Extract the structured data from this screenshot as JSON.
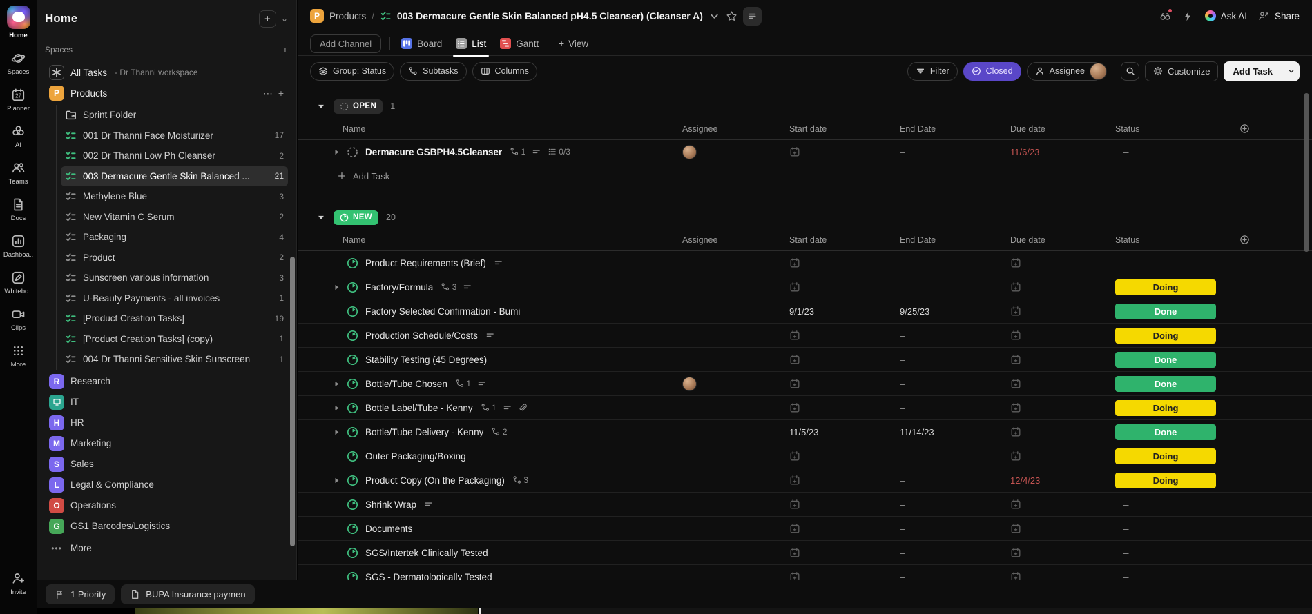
{
  "colors": {
    "accent_purple": "#5a47c8",
    "status_doing": "#f5d900",
    "status_done": "#2fb36c",
    "overdue_red": "#c25351",
    "green_icon": "#3fbf7f",
    "project_badge_yellow": "#eda43c"
  },
  "rail": {
    "items": [
      {
        "icon": "home-logo",
        "label": "Home"
      },
      {
        "icon": "planet-icon",
        "label": "Spaces"
      },
      {
        "icon": "calendar-icon",
        "label": "Planner"
      },
      {
        "icon": "ai-flower-icon",
        "label": "AI"
      },
      {
        "icon": "people-icon",
        "label": "Teams"
      },
      {
        "icon": "document-icon",
        "label": "Docs"
      },
      {
        "icon": "bar-chart-icon",
        "label": "Dashboa.."
      },
      {
        "icon": "whiteboard-icon",
        "label": "Whitebo.."
      },
      {
        "icon": "video-icon",
        "label": "Clips"
      },
      {
        "icon": "dots-grid-icon",
        "label": "More"
      }
    ],
    "invite": {
      "icon": "person-add-icon",
      "label": "Invite"
    }
  },
  "sidebar": {
    "title": "Home",
    "spaces_label": "Spaces",
    "all_tasks": {
      "label": "All Tasks",
      "suffix": "- Dr Thanni workspace"
    },
    "project": {
      "badge": "P",
      "badge_color": "#eda43c",
      "label": "Products"
    },
    "lists": [
      {
        "icon": "folder-icon",
        "label": "Sprint Folder",
        "count": ""
      },
      {
        "icon": "checklist-green-icon",
        "label": "001 Dr Thanni Face Moisturizer",
        "count": "17"
      },
      {
        "icon": "checklist-green-icon",
        "label": "002 Dr Thanni Low Ph Cleanser",
        "count": "2"
      },
      {
        "icon": "checklist-green-icon",
        "label": "003 Dermacure Gentle Skin Balanced ...",
        "count": "21",
        "selected": true
      },
      {
        "icon": "checklist-gray-icon",
        "label": "Methylene Blue",
        "count": "3"
      },
      {
        "icon": "checklist-gray-icon",
        "label": "New Vitamin C Serum",
        "count": "2"
      },
      {
        "icon": "checklist-gray-icon",
        "label": "Packaging",
        "count": "4"
      },
      {
        "icon": "checklist-gray-icon",
        "label": "Product",
        "count": "2"
      },
      {
        "icon": "checklist-gray-icon",
        "label": "Sunscreen various information",
        "count": "3"
      },
      {
        "icon": "checklist-gray-icon",
        "label": "U-Beauty Payments - all invoices",
        "count": "1"
      },
      {
        "icon": "checklist-green-icon",
        "label": "[Product Creation Tasks]",
        "count": "19"
      },
      {
        "icon": "checklist-green-icon",
        "label": "[Product Creation Tasks] (copy)",
        "count": "1"
      },
      {
        "icon": "checklist-gray-icon",
        "label": "004 Dr Thanni Sensitive Skin Sunscreen",
        "count": "1"
      }
    ],
    "spaces": [
      {
        "letter": "R",
        "color": "#7b68ee",
        "label": "Research"
      },
      {
        "letter": "",
        "glyph": "monitor-icon",
        "color": "#2ba58f",
        "label": "IT"
      },
      {
        "letter": "H",
        "color": "#7b68ee",
        "label": "HR"
      },
      {
        "letter": "M",
        "color": "#7b68ee",
        "label": "Marketing"
      },
      {
        "letter": "S",
        "color": "#7b68ee",
        "label": "Sales"
      },
      {
        "letter": "L",
        "color": "#7b68ee",
        "label": "Legal & Compliance"
      },
      {
        "letter": "O",
        "color": "#d14b44",
        "label": "Operations"
      },
      {
        "letter": "G",
        "color": "#46a758",
        "label": "GS1 Barcodes/Logistics"
      }
    ],
    "more_label": "More"
  },
  "header": {
    "breadcrumb": {
      "project_badge": "P",
      "project": "Products",
      "separator": "/",
      "title": "003 Dermacure Gentle Skin Balanced pH4.5 Cleanser) (Cleanser A)"
    },
    "ask_ai_label": "Ask AI",
    "share_label": "Share"
  },
  "tabs": {
    "add_channel": "Add Channel",
    "board": "Board",
    "list": "List",
    "gantt": "Gantt",
    "add_view": "View"
  },
  "toolbar": {
    "group": "Group: Status",
    "subtasks": "Subtasks",
    "columns": "Columns",
    "filter": "Filter",
    "closed": "Closed",
    "assignee": "Assignee",
    "customize": "Customize",
    "add_task": "Add Task"
  },
  "table": {
    "columns": [
      "Name",
      "Assignee",
      "Start date",
      "End Date",
      "Due date",
      "Status"
    ],
    "groups": [
      {
        "badge": "OPEN",
        "style": "open",
        "count": "1",
        "add_task_label": "Add Task",
        "rows": [
          {
            "name": "Dermacure GSBPH4.5Cleanser",
            "bold": true,
            "expandable": true,
            "icon": "dashed-circle-icon",
            "sub": "1",
            "desc": true,
            "checklist": "0/3",
            "assignee": "avatar",
            "start": "",
            "end": "–",
            "due": "11/6/23",
            "due_red": true,
            "status": "–"
          }
        ]
      },
      {
        "badge": "NEW",
        "style": "new",
        "count": "20",
        "rows": [
          {
            "name": "Product Requirements (Brief)",
            "icon": "clock-icon",
            "desc": true,
            "end": "–",
            "status": "–"
          },
          {
            "name": "Factory/Formula",
            "expandable": true,
            "icon": "clock-icon",
            "sub": "3",
            "desc": true,
            "end": "–",
            "status": "Doing"
          },
          {
            "name": "Factory Selected Confirmation - Bumi",
            "icon": "clock-icon",
            "start": "9/1/23",
            "end": "9/25/23",
            "status": "Done"
          },
          {
            "name": "Production Schedule/Costs",
            "icon": "clock-icon",
            "desc": true,
            "end": "–",
            "status": "Doing"
          },
          {
            "name": "Stability Testing (45 Degrees)",
            "icon": "clock-icon",
            "end": "–",
            "status": "Done"
          },
          {
            "name": "Bottle/Tube Chosen",
            "expandable": true,
            "icon": "clock-icon",
            "sub": "1",
            "desc": true,
            "assignee": "avatar",
            "end": "–",
            "status": "Done"
          },
          {
            "name": "Bottle Label/Tube - Kenny",
            "expandable": true,
            "icon": "clock-icon",
            "sub": "1",
            "desc": true,
            "attach": true,
            "end": "–",
            "status": "Doing"
          },
          {
            "name": "Bottle/Tube Delivery - Kenny",
            "expandable": true,
            "icon": "clock-icon",
            "sub": "2",
            "start": "11/5/23",
            "end": "11/14/23",
            "status": "Done"
          },
          {
            "name": "Outer Packaging/Boxing",
            "icon": "clock-icon",
            "end": "–",
            "status": "Doing"
          },
          {
            "name": "Product Copy (On the Packaging)",
            "expandable": true,
            "icon": "clock-icon",
            "sub": "3",
            "end": "–",
            "due": "12/4/23",
            "due_red": true,
            "status": "Doing"
          },
          {
            "name": "Shrink Wrap",
            "icon": "clock-icon",
            "desc": true,
            "end": "–",
            "status": "–"
          },
          {
            "name": "Documents",
            "icon": "clock-icon",
            "end": "–",
            "status": "–"
          },
          {
            "name": "SGS/Intertek Clinically Tested",
            "icon": "clock-icon",
            "end": "–",
            "status": "–"
          },
          {
            "name": "SGS - Dermatologically Tested",
            "icon": "clock-icon",
            "end": "–",
            "status": "–"
          }
        ]
      }
    ]
  },
  "footer": {
    "priority": "1 Priority",
    "doc": "BUPA Insurance paymen"
  }
}
